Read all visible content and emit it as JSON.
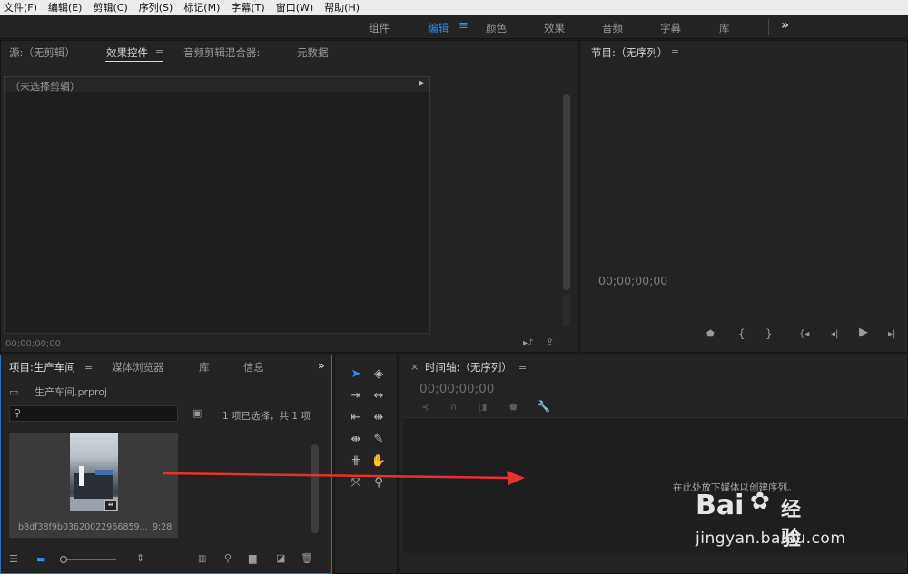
{
  "menu": [
    "文件(F)",
    "编辑(E)",
    "剪辑(C)",
    "序列(S)",
    "标记(M)",
    "字幕(T)",
    "窗口(W)",
    "帮助(H)"
  ],
  "workspaces": {
    "items": [
      "组件",
      "编辑",
      "颜色",
      "效果",
      "音频",
      "字幕",
      "库"
    ],
    "active": "编辑",
    "overflow": "»"
  },
  "source_panel": {
    "tabs": [
      "源:（无剪辑）",
      "效果控件",
      "音频剪辑混合器:",
      "元数据"
    ],
    "active_tab": "效果控件",
    "menu_icon": "≡",
    "header": "（未选择剪辑）",
    "timecode": "00;00;00;00"
  },
  "program_panel": {
    "title": "节目:（无序列）",
    "menu_icon": "≡",
    "timecode": "00;00;00;00"
  },
  "project_panel": {
    "tabs": [
      "项目:生产车间",
      "媒体浏览器",
      "库",
      "信息"
    ],
    "active_tab": "项目:生产车间",
    "menu_icon": "≡",
    "overflow": "»",
    "project_file": "生产车间.prproj",
    "selection_status": "1 项已选择，共 1 项",
    "clip": {
      "name": "b8df38f9b03620022966859...",
      "duration": "9;28"
    }
  },
  "timeline_panel": {
    "close": "×",
    "title": "时间轴:（无序列）",
    "menu_icon": "≡",
    "timecode": "00;00;00;00",
    "drop_hint": "在此处放下媒体以创建序列。"
  },
  "watermark": {
    "brand": "Bai",
    "brand_suffix": "经验",
    "url": "jingyan.baidu.com"
  },
  "colors": {
    "accent": "#2d8ceb",
    "arrow": "#e8322c"
  }
}
